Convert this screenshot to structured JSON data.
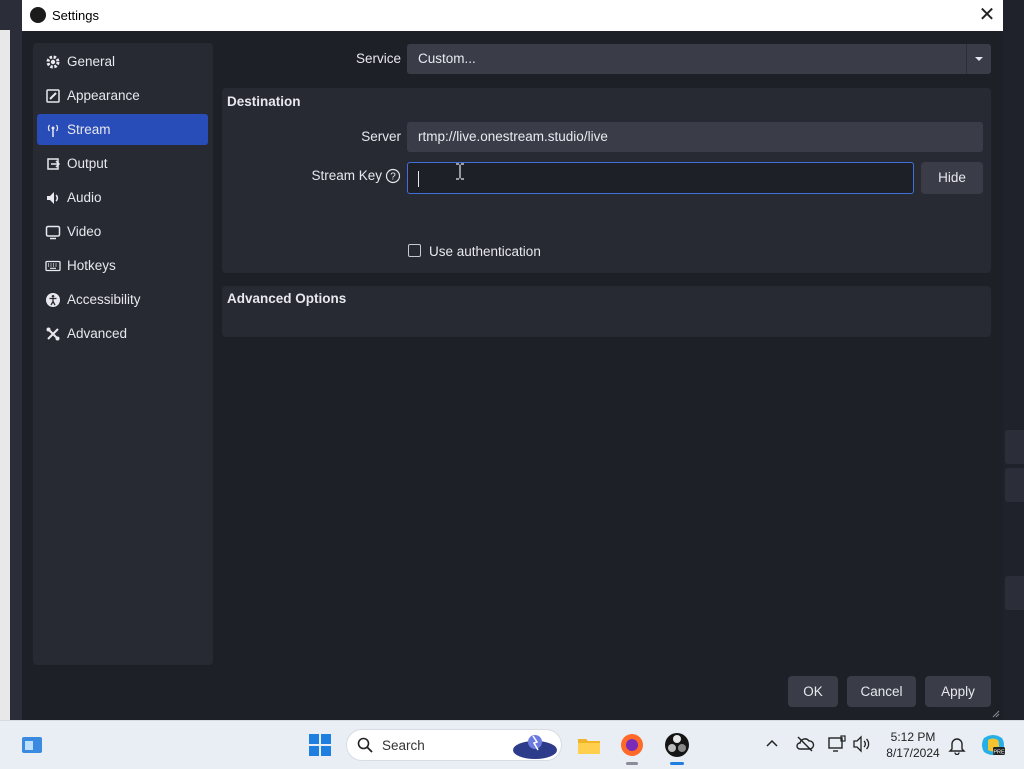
{
  "window": {
    "title": "Settings"
  },
  "sidebar": {
    "items": [
      {
        "label": "General",
        "icon": "gear-icon"
      },
      {
        "label": "Appearance",
        "icon": "brush-icon"
      },
      {
        "label": "Stream",
        "icon": "broadcast-icon"
      },
      {
        "label": "Output",
        "icon": "output-icon"
      },
      {
        "label": "Audio",
        "icon": "speaker-icon"
      },
      {
        "label": "Video",
        "icon": "monitor-icon"
      },
      {
        "label": "Hotkeys",
        "icon": "keyboard-icon"
      },
      {
        "label": "Accessibility",
        "icon": "accessibility-icon"
      },
      {
        "label": "Advanced",
        "icon": "tools-icon"
      }
    ],
    "active": "Stream"
  },
  "stream": {
    "service_label": "Service",
    "service_value": "Custom...",
    "destination_title": "Destination",
    "server_label": "Server",
    "server_value": "rtmp://live.onestream.studio/live",
    "stream_key_label": "Stream Key",
    "stream_key_value": "",
    "hide_label": "Hide",
    "use_auth_label": "Use authentication",
    "use_auth_checked": false,
    "advanced_title": "Advanced Options"
  },
  "footer": {
    "ok": "OK",
    "cancel": "Cancel",
    "apply": "Apply"
  },
  "taskbar": {
    "search_placeholder": "Search",
    "time": "5:12 PM",
    "date": "8/17/2024"
  },
  "colors": {
    "accent": "#284cb8",
    "dialog_bg": "#1e2028",
    "panel_bg": "#272a33",
    "field_bg": "#3a3d48"
  }
}
